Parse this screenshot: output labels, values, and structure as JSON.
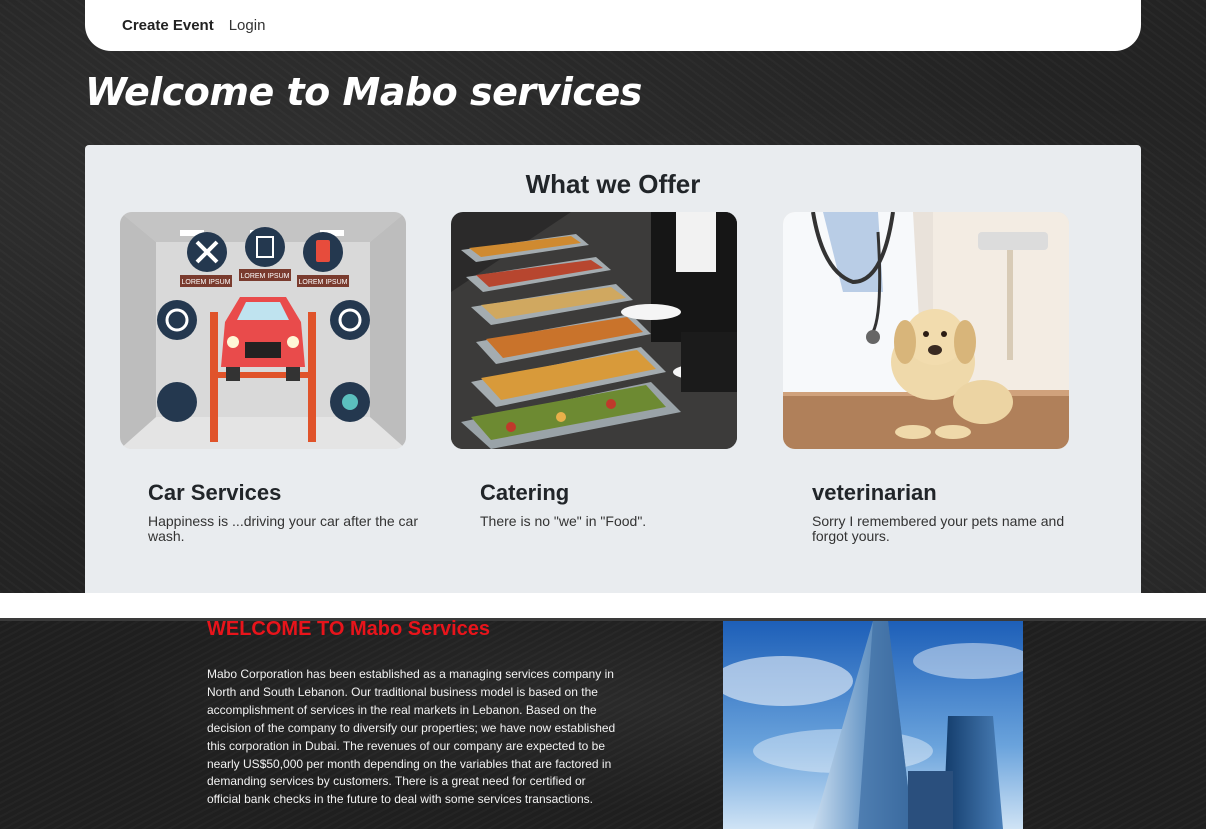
{
  "nav": {
    "brand_label": "Create Event",
    "login_label": "Login"
  },
  "hero": {
    "title": "Welcome to Mabo services"
  },
  "offer": {
    "title": "What we Offer",
    "cards": [
      {
        "title": "Car Services",
        "text": "Happiness is ...driving your car after the car wash.",
        "image": "car-service-illustration"
      },
      {
        "title": "Catering",
        "text": "There is no \"we\" in \"Food\".",
        "image": "catering-buffet-photo"
      },
      {
        "title": "veterinarian",
        "text": "Sorry I remembered your pets name and forgot yours.",
        "image": "veterinarian-puppy-photo"
      }
    ],
    "car_labels": [
      "LOREM IPSUM",
      "LOREM IPSUM",
      "LOREM IPSUM"
    ]
  },
  "about": {
    "title": "WELCOME TO Mabo Services",
    "text": "Mabo Corporation has been established as a managing services company in North and South Lebanon. Our traditional business model is based on the accomplishment of services in the real markets in Lebanon. Based on the decision of the company to diversify our properties; we have now established this corporation in Dubai. The revenues of our company are expected to be nearly US$50,000 per month depending on the variables that are factored in demanding services by customers. There is a great need for certified or official bank checks in the future to deal with some services transactions.",
    "image": "skyscraper-photo"
  },
  "colors": {
    "accent_red": "#e8141b",
    "panel_bg": "#e9ecef",
    "background": "#232323"
  }
}
